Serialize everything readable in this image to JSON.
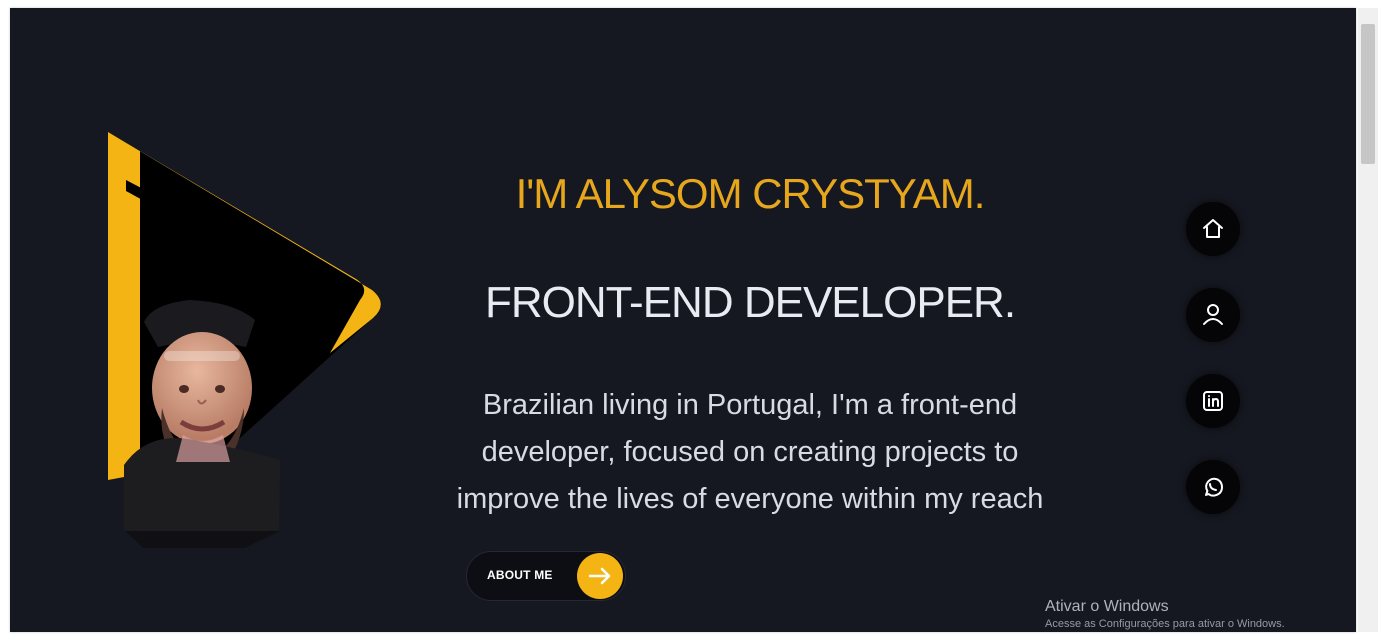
{
  "hero": {
    "name": "I'M ALYSOM CRYSTYAM.",
    "role": "FRONT-END DEVELOPER.",
    "bio": "Brazilian living in Portugal, I'm a front-end developer, focused on creating projects to improve the lives of everyone within my reach",
    "button_label": "ABOUT ME"
  },
  "social_links": [
    {
      "icon": "home-icon",
      "label": "home"
    },
    {
      "icon": "user-icon",
      "label": "profile"
    },
    {
      "icon": "linkedin-icon",
      "label": "linkedin"
    },
    {
      "icon": "whatsapp-icon",
      "label": "whatsapp"
    }
  ],
  "watermark": {
    "title": "Ativar o Windows",
    "subtitle": "Acesse as Configurações para ativar o Windows."
  },
  "colors": {
    "background": "#161821",
    "accent": "#f4b514",
    "heading_light": "#e9ebf2",
    "button_dark": "#0d0e13"
  }
}
